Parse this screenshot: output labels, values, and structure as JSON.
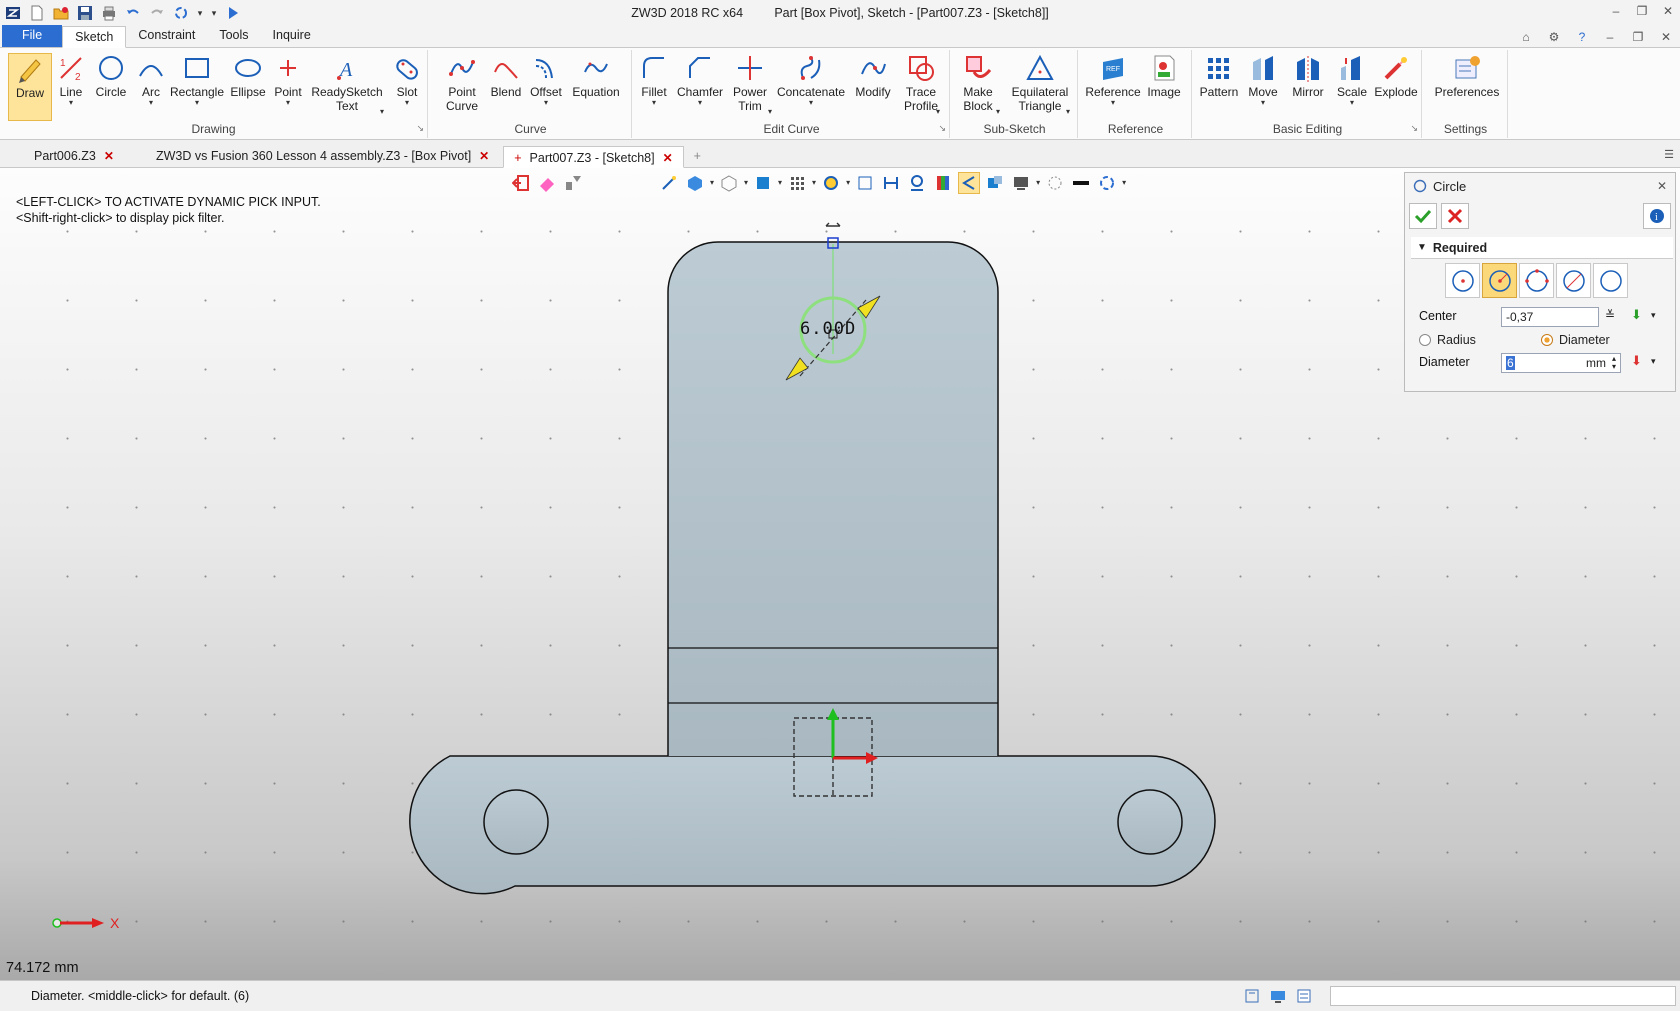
{
  "title": {
    "app": "ZW3D 2018 RC x64",
    "doc": "Part [Box Pivot],  Sketch - [Part007.Z3 - [Sketch8]]"
  },
  "ribbon_tabs": [
    "File",
    "Sketch",
    "Constraint",
    "Tools",
    "Inquire"
  ],
  "ribbon": {
    "drawing": {
      "label": "Drawing",
      "draw": "Draw",
      "line": "Line",
      "circle": "Circle",
      "arc": "Arc",
      "rectangle": "Rectangle",
      "ellipse": "Ellipse",
      "point": "Point",
      "readysketch_1": "ReadySketch",
      "readysketch_2": "Text",
      "slot": "Slot"
    },
    "curve": {
      "label": "Curve",
      "point_curve_1": "Point",
      "point_curve_2": "Curve",
      "blend": "Blend",
      "offset": "Offset",
      "equation": "Equation"
    },
    "edit_curve": {
      "label": "Edit Curve",
      "fillet": "Fillet",
      "chamfer": "Chamfer",
      "power_trim_1": "Power",
      "power_trim_2": "Trim",
      "concatenate": "Concatenate",
      "modify": "Modify",
      "trace_profile_1": "Trace",
      "trace_profile_2": "Profile"
    },
    "sub_sketch": {
      "label": "Sub-Sketch",
      "make_block_1": "Make",
      "make_block_2": "Block",
      "eq_tri_1": "Equilateral",
      "eq_tri_2": "Triangle"
    },
    "reference": {
      "label": "Reference",
      "reference": "Reference",
      "image": "Image"
    },
    "basic_editing": {
      "label": "Basic Editing",
      "pattern": "Pattern",
      "move": "Move",
      "mirror": "Mirror",
      "scale": "Scale",
      "explode": "Explode"
    },
    "settings": {
      "label": "Settings",
      "preferences": "Preferences"
    }
  },
  "doc_tabs": [
    {
      "label": "Part006.Z3"
    },
    {
      "label": "ZW3D vs Fusion 360 Lesson 4 assembly.Z3 - [Box Pivot]"
    },
    {
      "label": "Part007.Z3 - [Sketch8]"
    }
  ],
  "viewport": {
    "hint_1": "<LEFT-CLICK> TO ACTIVATE DYNAMIC PICK INPUT.",
    "hint_2": "<Shift-right-click> to display pick filter.",
    "dimension_text": "6.00D",
    "axis_label": "X",
    "measure": "74.172 mm"
  },
  "panel": {
    "title": "Circle",
    "required": "Required",
    "center_label": "Center",
    "center_value": "-0,37",
    "radius_label": "Radius",
    "diameter_option": "Diameter",
    "diameter_label": "Diameter",
    "diameter_value": "6",
    "diameter_unit": "mm",
    "selected_option": "Diameter"
  },
  "status": {
    "text": "Diameter.   <middle-click> for default. (6)"
  },
  "colors": {
    "accent": "#2b6dd0",
    "part_fill": "#b9c7cf",
    "preview_circle": "#8ee07e",
    "x_axis": "#e02020",
    "y_axis": "#1fbf1f"
  }
}
